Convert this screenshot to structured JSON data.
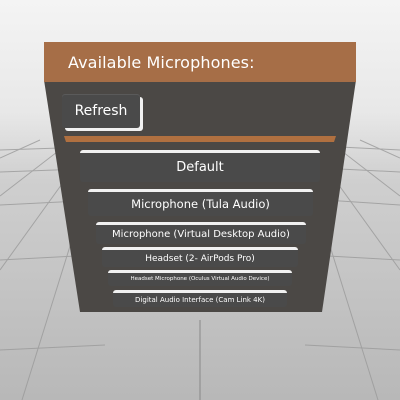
{
  "panel": {
    "title": "Available Microphones:",
    "refresh_label": "Refresh",
    "microphones": [
      "Default",
      "Microphone (Tula Audio)",
      "Microphone (Virtual Desktop Audio)",
      "Headset (2- AirPods Pro)",
      "Headset Microphone (Oculus Virtual Audio Device)",
      "Digital Audio Interface (Cam Link 4K)"
    ]
  },
  "colors": {
    "header": "#a66e47",
    "panel_body": "#4b4845",
    "button": "#4a4a4a",
    "separator": "#b07040",
    "grid_floor": "#b8b8b8",
    "sky": "#f0f0f0"
  }
}
